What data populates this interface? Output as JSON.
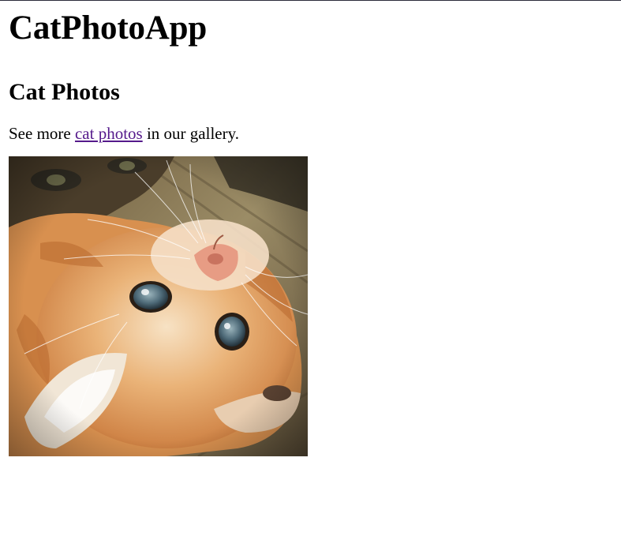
{
  "page": {
    "title": "CatPhotoApp",
    "subtitle": "Cat Photos"
  },
  "intro": {
    "before_link": "See more ",
    "link_text": "cat photos",
    "after_link": " in our gallery."
  },
  "image": {
    "subject": "orange kitten lying upside down on wooden floor",
    "colors": {
      "fur": "#e5a263",
      "fur_light": "#f3dcc0",
      "floor": "#8b7c58",
      "eye": "#4d6a78"
    }
  },
  "colors": {
    "text": "#000000",
    "visited_link": "#551a8b",
    "background": "#ffffff"
  }
}
